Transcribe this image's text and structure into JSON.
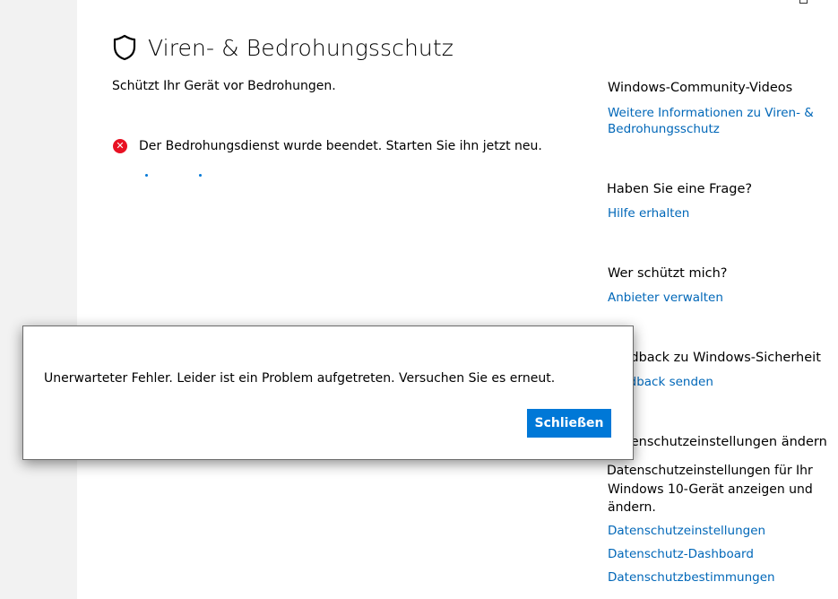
{
  "header": {
    "title": "Viren- & Bedrohungsschutz",
    "subtitle": "Schützt Ihr Gerät vor Bedrohungen."
  },
  "status": {
    "message": "Der Bedrohungsdienst wurde beendet. Starten Sie ihn jetzt neu.",
    "icon": "error-icon"
  },
  "sidebar": {
    "community": {
      "heading": "Windows-Community-Videos",
      "link_line1": "Weitere Informationen zu Viren- &",
      "link_line2": "Bedrohungsschutz"
    },
    "question": {
      "heading": "Haben Sie eine Frage?",
      "link": "Hilfe erhalten"
    },
    "protector": {
      "heading": "Wer schützt mich?",
      "link": "Anbieter verwalten"
    },
    "feedback": {
      "heading": "Feedback zu Windows-Sicherheit",
      "link": "Feedback senden"
    },
    "privacy": {
      "heading": "Datenschutzeinstellungen ändern",
      "text_line1": "Datenschutzeinstellungen für Ihr",
      "text_line2": "Windows 10-Gerät anzeigen und",
      "text_line3": "ändern.",
      "links": [
        "Datenschutzeinstellungen",
        "Datenschutz-Dashboard",
        "Datenschutzbestimmungen"
      ]
    }
  },
  "dialog": {
    "message": "Unerwarteter Fehler. Leider ist ein Problem aufgetreten. Versuchen Sie es erneut.",
    "close_label": "Schließen"
  },
  "colors": {
    "accent": "#0078d7",
    "link": "#0067b8",
    "error": "#e81123"
  }
}
